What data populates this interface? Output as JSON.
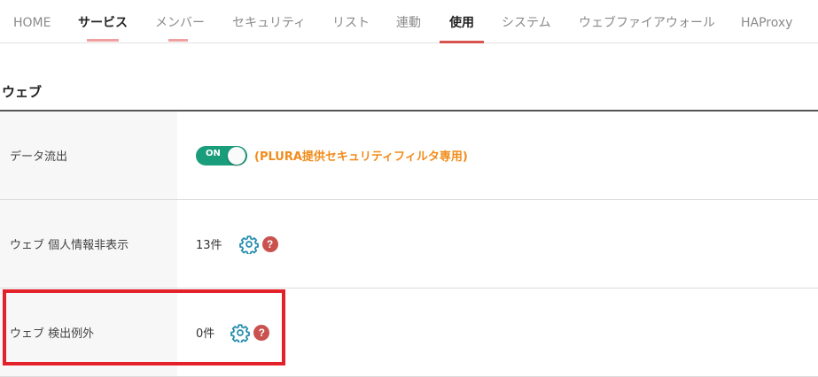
{
  "tabs": [
    {
      "label": "HOME"
    },
    {
      "label": "サービス"
    },
    {
      "label": "メンバー"
    },
    {
      "label": "セキュリティ"
    },
    {
      "label": "リスト"
    },
    {
      "label": "連動"
    },
    {
      "label": "使用"
    },
    {
      "label": "システム"
    },
    {
      "label": "ウェブファイアウォール"
    },
    {
      "label": "HAProxy"
    }
  ],
  "active_tab": "使用",
  "section": {
    "title": "ウェブ"
  },
  "rows": [
    {
      "label": "データ流出",
      "toggle_label": "ON",
      "toggle_state": "on",
      "note": "(PLURA提供セキュリティフィルタ専用)"
    },
    {
      "label": "ウェブ 個人情報非表示",
      "count": "13件"
    },
    {
      "label": "ウェブ 検出例外",
      "count": "0件"
    }
  ],
  "colors": {
    "toggle_on": "#1a9d7b",
    "note": "#f08c1a",
    "help": "#c9524f",
    "gear": "#2a8fb0",
    "active_tab_underline": "#d9534f",
    "highlight": "#e4202a"
  }
}
